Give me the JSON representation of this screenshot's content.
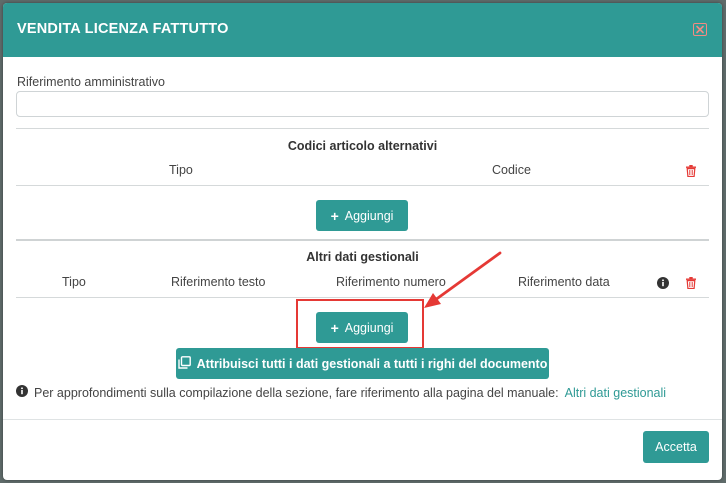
{
  "modal": {
    "title": "VENDITA LICENZA FATTUTTO",
    "close_icon": "close-icon"
  },
  "admin_reference": {
    "label": "Riferimento amministrativo",
    "value": "",
    "placeholder": ""
  },
  "alt_codes": {
    "title": "Codici articolo alternativi",
    "columns": [
      "Tipo",
      "Codice"
    ],
    "delete_icon": "trash-icon",
    "add_label": "Aggiungi"
  },
  "management": {
    "title": "Altri dati gestionali",
    "columns": [
      "Tipo",
      "Riferimento testo",
      "Riferimento numero",
      "Riferimento data"
    ],
    "info_icon": "info-icon",
    "delete_icon": "trash-icon",
    "add_label": "Aggiungi",
    "assign_label": "Attribuisci tutti i dati gestionali a tutti i righi del documento"
  },
  "info": {
    "text": "Per approfondimenti sulla compilazione della sezione, fare riferimento alla pagina del manuale:",
    "link": "Altri dati gestionali"
  },
  "footer": {
    "accept_label": "Accetta"
  },
  "colors": {
    "accent": "#2f9a95",
    "danger": "#e53935",
    "link": "#2f9a95"
  }
}
